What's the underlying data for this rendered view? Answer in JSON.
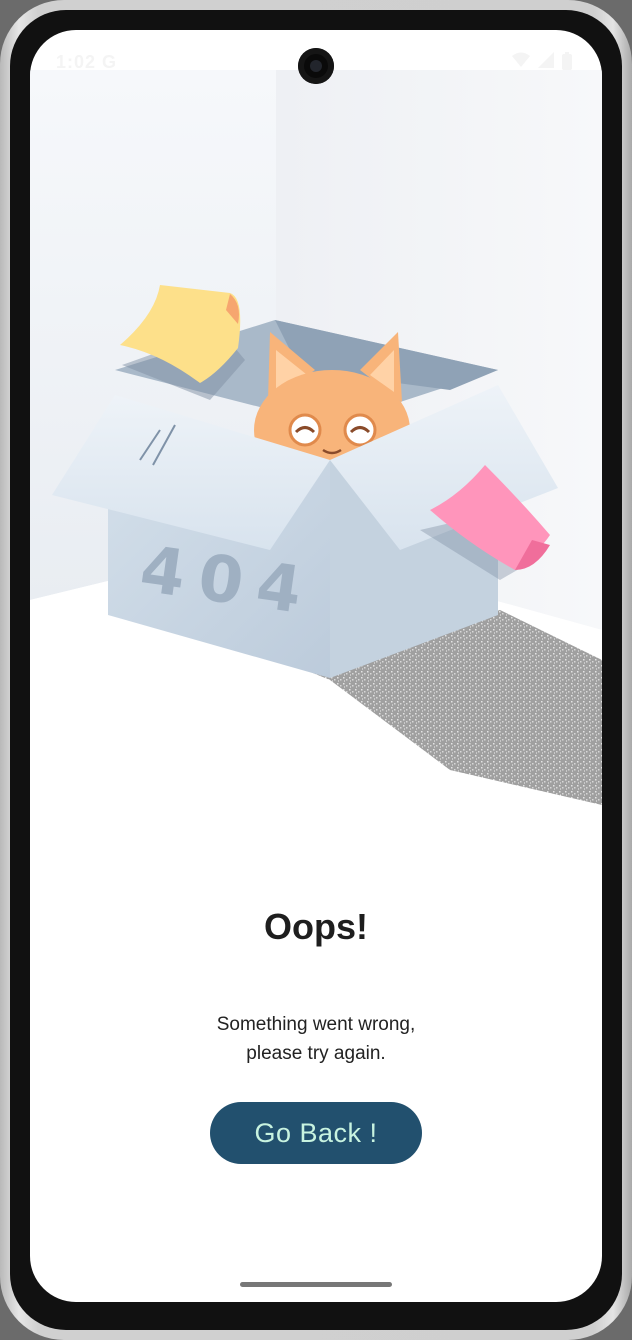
{
  "status_bar": {
    "time": "1:02",
    "carrier_glyph": "G",
    "icons": [
      "wifi-icon",
      "signal-icon",
      "battery-icon"
    ]
  },
  "illustration": {
    "box_label": "404"
  },
  "error": {
    "title": "Oops!",
    "message_line1": "Something went wrong,",
    "message_line2": "please try again.",
    "button_label": "Go Back !"
  },
  "colors": {
    "button_bg": "#22506e",
    "button_text": "#c8f3e0",
    "box": "#c9d7e4",
    "note_yellow": "#fde08a",
    "note_pink": "#ff95bb",
    "cat": "#f8b47a"
  }
}
